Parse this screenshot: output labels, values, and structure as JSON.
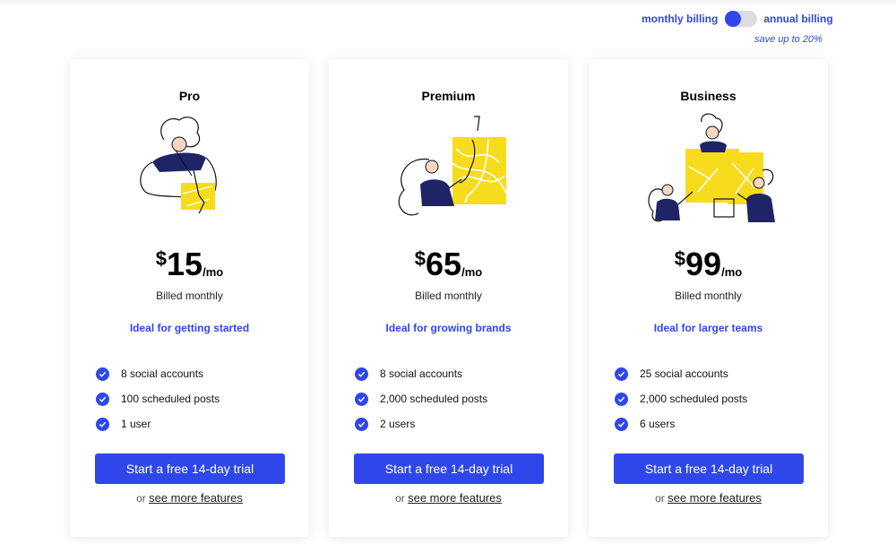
{
  "billing": {
    "monthly_label": "monthly billing",
    "annual_label": "annual billing",
    "save_note": "save up to 20%",
    "selected": "monthly"
  },
  "colors": {
    "accent": "#2f47ea",
    "illustration_yellow": "#f7dc1e",
    "illustration_navy": "#1f2466"
  },
  "plans": [
    {
      "name": "Pro",
      "illustration": "person-working-illustration",
      "currency": "$",
      "amount": "15",
      "period": "/mo",
      "billed": "Billed monthly",
      "ideal": "Ideal for getting started",
      "features": [
        "8 social accounts",
        "100 scheduled posts",
        "1 user"
      ],
      "cta": "Start a free 14-day trial",
      "more_prefix": "or",
      "more_link": "see more features"
    },
    {
      "name": "Premium",
      "illustration": "person-presenting-illustration",
      "currency": "$",
      "amount": "65",
      "period": "/mo",
      "billed": "Billed monthly",
      "ideal": "Ideal for growing brands",
      "features": [
        "8 social accounts",
        "2,000 scheduled posts",
        "2 users"
      ],
      "cta": "Start a free 14-day trial",
      "more_prefix": "or",
      "more_link": "see more features"
    },
    {
      "name": "Business",
      "illustration": "team-collaborating-illustration",
      "currency": "$",
      "amount": "99",
      "period": "/mo",
      "billed": "Billed monthly",
      "ideal": "Ideal for larger teams",
      "features": [
        "25 social accounts",
        "2,000 scheduled posts",
        "6 users"
      ],
      "cta": "Start a free 14-day trial",
      "more_prefix": "or",
      "more_link": "see more features"
    }
  ]
}
